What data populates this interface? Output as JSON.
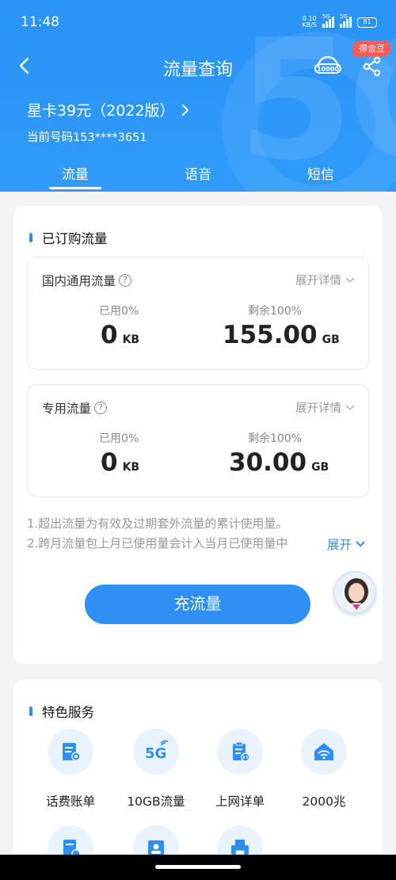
{
  "status_bar": {
    "time": "11:48",
    "net_speed_value": "0.10",
    "net_speed_unit": "KB/S",
    "sim1": "5G",
    "sim2": "5G",
    "battery": "81"
  },
  "nav": {
    "title": "流量查询",
    "badge": "得金豆"
  },
  "plan": {
    "name": "星卡39元（2022版）",
    "phone": "当前号码153****3651"
  },
  "tabs": [
    {
      "label": "流量",
      "active": true
    },
    {
      "label": "语音",
      "active": false
    },
    {
      "label": "短信",
      "active": false
    }
  ],
  "subscribed": {
    "title": "已订购流量",
    "boxes": [
      {
        "name": "国内通用流量",
        "expand": "展开详情",
        "used_label": "已用0%",
        "used_value": "0",
        "used_unit": "KB",
        "remain_label": "剩余100%",
        "remain_value": "155.00",
        "remain_unit": "GB"
      },
      {
        "name": "专用流量",
        "expand": "展开详情",
        "used_label": "已用0%",
        "used_value": "0",
        "used_unit": "KB",
        "remain_label": "剩余100%",
        "remain_value": "30.00",
        "remain_unit": "GB"
      }
    ],
    "notes": [
      "1.超出流量为有效及过期套外流量的累计使用量。",
      "2.跨月流量包上月已使用量会计入当月已使用量中"
    ],
    "expand_link": "展开",
    "recharge_button": "充流量"
  },
  "services": {
    "title": "特色服务",
    "items": [
      {
        "label": "话费账单",
        "icon": "bill-icon"
      },
      {
        "label": "10GB流量",
        "icon": "5g-icon"
      },
      {
        "label": "上网详单",
        "icon": "usage-detail-icon"
      },
      {
        "label": "2000兆",
        "icon": "wifi-home-icon"
      }
    ],
    "more_icons": [
      "document-icon",
      "contact-card-icon",
      "printer-icon"
    ]
  },
  "colors": {
    "header": "#2f9bfa",
    "accent": "#2f8ff5",
    "badge": "#ff5a5a"
  }
}
